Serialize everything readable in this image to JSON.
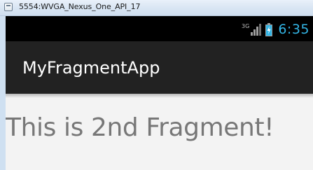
{
  "window": {
    "title": "5554:WVGA_Nexus_One_API_17"
  },
  "status_bar": {
    "network_type": "3G",
    "signal_icon": "signal-bars-icon",
    "battery_icon": "battery-charging-icon",
    "time": "6:35",
    "time_color": "#33b5e5"
  },
  "action_bar": {
    "title": "MyFragmentApp",
    "background_color": "#222222"
  },
  "content": {
    "message": "This is 2nd Fragment!",
    "background_color": "#f3f3f3"
  }
}
